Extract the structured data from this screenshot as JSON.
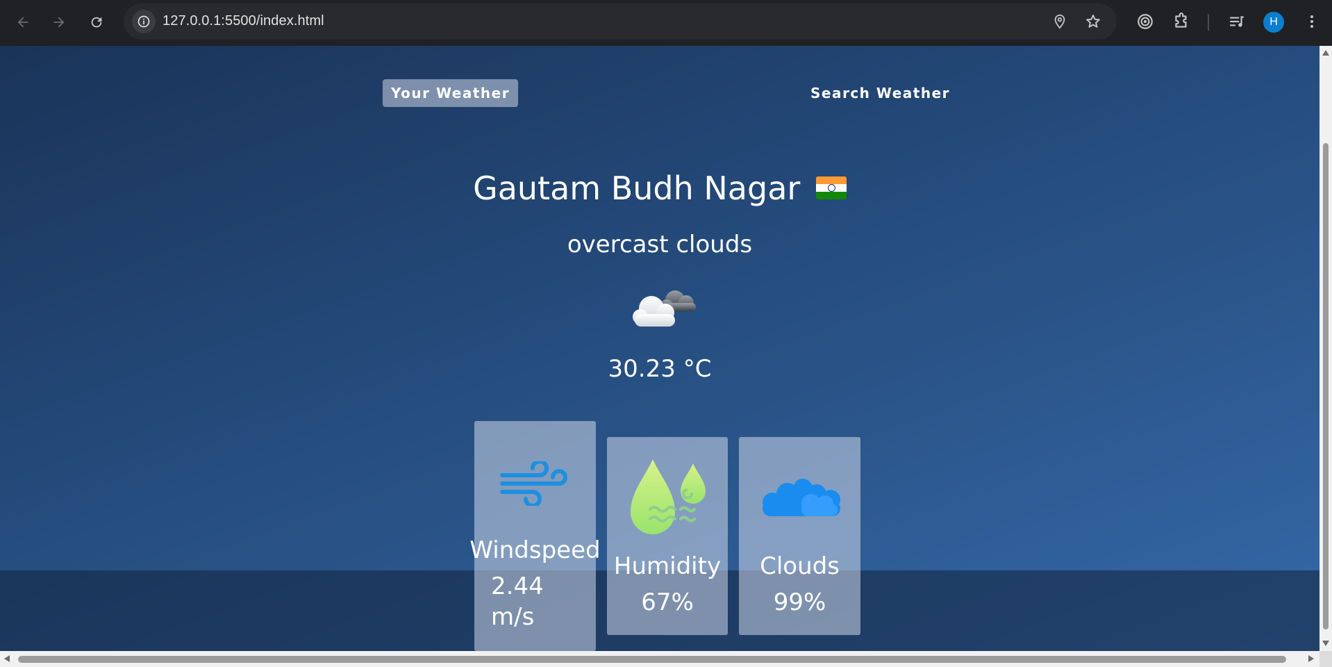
{
  "browser": {
    "url": "127.0.0.1:5500/index.html",
    "profile_initial": "H",
    "avatar_color": "#0b7fcf"
  },
  "tabs": {
    "your_weather": "Your Weather",
    "search_weather": "Search Weather"
  },
  "weather": {
    "city": "Gautam Budh Nagar",
    "country_flag": "india-flag",
    "description": "overcast clouds",
    "icon": "overcast-clouds-icon",
    "temperature": "30.23 °C"
  },
  "cards": {
    "windspeed": {
      "label": "Windspeed",
      "value_line1": "2.44",
      "value_line2": "m/s",
      "icon": "wind-icon"
    },
    "humidity": {
      "label": "Humidity",
      "value": "67%",
      "icon": "humidity-drops-icon"
    },
    "clouds": {
      "label": "Clouds",
      "value": "99%",
      "icon": "cloud-icon"
    }
  },
  "colors": {
    "background_top": "#1a3358",
    "background_bottom": "#3569a8",
    "card_bg": "rgba(214,223,238,0.52)",
    "wind_icon": "#1e8fe0",
    "humidity_icon": "#b7ec77",
    "cloud_icon": "#1a8cf0"
  }
}
